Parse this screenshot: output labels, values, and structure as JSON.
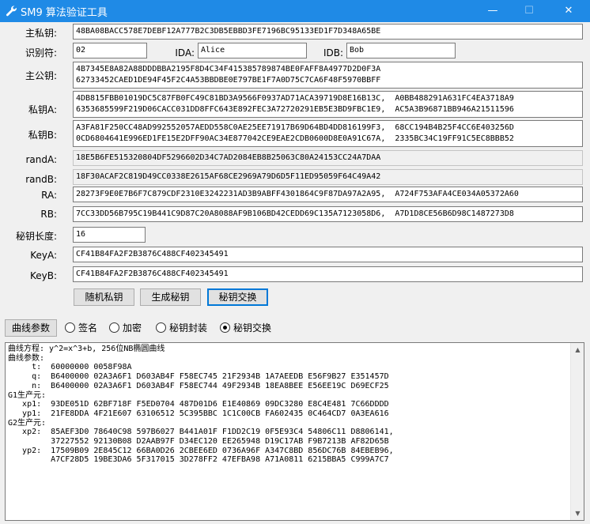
{
  "window": {
    "title": "SM9 算法验证工具",
    "min_label": "—",
    "max_label": "☐",
    "close_label": "✕"
  },
  "fields": {
    "master_private_key": {
      "label": "主私钥:",
      "value": "48BA08BACC578E7DEBF12A777B2C3DB5EBBD3FE7196BC95133ED1F7D348A65BE"
    },
    "identifier": {
      "label": "识别符:",
      "value": "02"
    },
    "ida": {
      "label": "IDA:",
      "value": "Alice"
    },
    "idb": {
      "label": "IDB:",
      "value": "Bob"
    },
    "master_public_key": {
      "label": "主公钥:",
      "value": "4B7345E8A82A88DDDBBA2195F8D4C34F415385789874BE0FAFF8A4977D2D0F3A\n62733452CAED1DE94F45F2C4A53BBDBE0E797BE1F7A0D75C7CA6F48F5970BBFF"
    },
    "private_key_a": {
      "label": "私钥A:",
      "value": "4DB815FBB01019DC5C87FB0FC49C81BD3A9566F0937AD71ACA39719D8E16B13C,  A0BB488291A631FC4EA3718A9\n6353685599F219D06CACC031DD8FFC643E892FEC3A72720291EB5E3BD9FBC1E9,  AC5A3B96871BB946A21511596"
    },
    "private_key_b": {
      "label": "私钥B:",
      "value": "A3FA81F250CC48AD992552057AEDD558C0AE25EE71917B69D64BD4DD816199F3,  68CC194B4B25F4CC6E403256D\n0CD6804641E996ED1FE15E2DFF90AC34E877042CE9EAE2CDB0600D8E0A91C67A,  2335BC34C19FF91C5EC8BBB52"
    },
    "rand_a": {
      "label": "randA:",
      "value": "18E5B6FE515320804DF5296602D34C7AD2084EB8B25063C80A24153CC24A7DAA"
    },
    "rand_b": {
      "label": "randB:",
      "value": "18F30ACAF2C819D49CC0338E2615AF68CE2969A79D6D5F11ED95059F64C49A42"
    },
    "ra": {
      "label": "RA:",
      "value": "28273F9E0E7B6F7C879CDF2310E3242231AD3B9ABFF4301864C9F87DA97A2A95,  A724F753AFA4CE034A05372A60"
    },
    "rb": {
      "label": "RB:",
      "value": "7CC33DD56B795C19B441C9D87C20A8088AF9B106BD42CEDD69C135A7123058D6,  A7D1D8CE56B6D98C1487273D8"
    },
    "key_length": {
      "label": "秘钥长度:",
      "value": "16"
    },
    "key_a": {
      "label": "KeyA:",
      "value": "CF41B84FA2F2B3876C488CF402345491"
    },
    "key_b": {
      "label": "KeyB:",
      "value": "CF41B84FA2F2B3876C488CF402345491"
    }
  },
  "buttons": {
    "random_private_key": "随机私钥",
    "generate_key": "生成秘钥",
    "key_exchange": "秘钥交换",
    "curve_params": "曲线参数"
  },
  "modes": {
    "selected": "秘钥交换",
    "options": [
      "签名",
      "加密",
      "秘钥封装",
      "秘钥交换"
    ]
  },
  "output_text": "曲线方程: y^2=x^3+b, 256位NB椭圆曲线\n曲线参数:\n     t:  60000000 0058F98A\n     q:  B6400000 02A3A6F1 D603AB4F F58EC745 21F2934B 1A7AEEDB E56F9B27 E351457D\n     n:  B6400000 02A3A6F1 D603AB4F F58EC744 49F2934B 18EA8BEE E56EE19C D69ECF25\nG1生产元:\n   xp1:  93DE051D 62BF718F F5ED0704 487D01D6 E1E40869 09DC3280 E8C4E481 7C66DDDD\n   yp1:  21FE8DDA 4F21E607 63106512 5C395BBC 1C1C00CB FA602435 0C464CD7 0A3EA616\nG2生产元:\n   xp2:  85AEF3D0 78640C98 597B6027 B441A01F F1DD2C19 0F5E93C4 54806C11 D8806141,\n         37227552 92130B08 D2AAB97F D34EC120 EE265948 D19C17AB F9B7213B AF82D65B\n   yp2:  17509B09 2E845C12 66BA0D26 2CBEE6ED 0736A96F A347C8BD 856DC76B 84EBEB96,\n         A7CF28D5 19BE3DA6 5F317015 3D278FF2 47EFBA98 A71A0811 6215BBA5 C999A7C7",
  "icons": {
    "app": "wrench-icon",
    "radio_on": "radio-selected-icon",
    "radio_off": "radio-unselected-icon"
  },
  "colors": {
    "titlebar": "#1f8ae6",
    "focus_border": "#0078d7"
  }
}
